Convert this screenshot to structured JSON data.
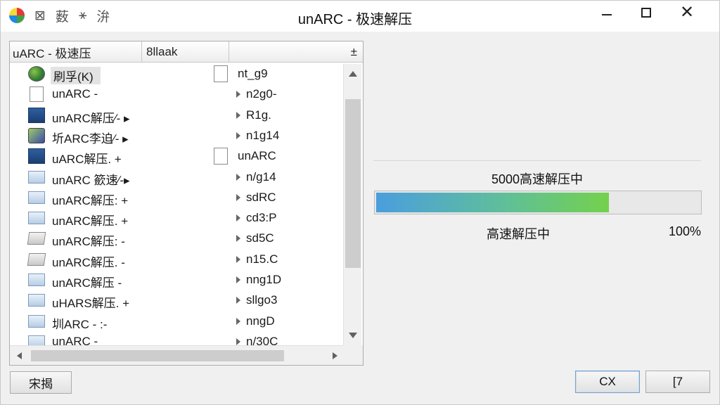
{
  "window": {
    "title": "unARC - 极速解压",
    "toolbar_glyphs": [
      "⊠",
      "薮",
      "⚹",
      "㳎"
    ]
  },
  "list": {
    "columns": [
      "uARC - 极速压",
      "8llaak",
      "±"
    ],
    "rows": [
      {
        "icon": "globe-icon",
        "name": "刷孚(K)",
        "size": "nt_g9",
        "size_icon": "doc"
      },
      {
        "icon": "doc-icon",
        "name": "unARC -",
        "size": "n2g0-",
        "size_icon": "arrow"
      },
      {
        "icon": "blue-window-icon",
        "name": "unARC解压∕- ▸",
        "size": "R1g.",
        "size_icon": "arrow"
      },
      {
        "icon": "cube-icon",
        "name": "圻ARC李迫∕- ▸",
        "size": "n1g14",
        "size_icon": "arrow"
      },
      {
        "icon": "blue-window-icon",
        "name": "uARC解压. +",
        "size": "unARC",
        "size_icon": "doc"
      },
      {
        "icon": "folder-icon",
        "name": "unARC 籨速∕-▸",
        "size": "n/g14",
        "size_icon": "arrow"
      },
      {
        "icon": "folder-icon",
        "name": "unARC解压: +",
        "size": "sdRC",
        "size_icon": "arrow"
      },
      {
        "icon": "folder-icon",
        "name": "unARC解压. +",
        "size": "cd3:P",
        "size_icon": "arrow"
      },
      {
        "icon": "stamp-icon",
        "name": "unARC解压: -",
        "size": "sd5C",
        "size_icon": "arrow"
      },
      {
        "icon": "stamp-icon",
        "name": "unARC解压. -",
        "size": "n15.C",
        "size_icon": "arrow"
      },
      {
        "icon": "folder-icon",
        "name": "unARC解压 -",
        "size": "nng1D",
        "size_icon": "arrow"
      },
      {
        "icon": "folder-icon",
        "name": "uHARS解压. +",
        "size": "sllgo3",
        "size_icon": "arrow"
      },
      {
        "icon": "folder-icon",
        "name": "圳ARC - :-",
        "size": "nngD",
        "size_icon": "arrow"
      },
      {
        "icon": "folder-icon",
        "name": "unARC -",
        "size": "n/30C",
        "size_icon": "arrow"
      }
    ]
  },
  "progress": {
    "status_top": "5000高速解压中",
    "status_bottom": "高速解压中",
    "percent_label": "100%",
    "fill_fraction": 0.72,
    "colors": {
      "start": "#4a9ede",
      "end": "#74d14c"
    }
  },
  "buttons": {
    "left": "宋揭",
    "ok": "CX",
    "cancel": "[7"
  }
}
